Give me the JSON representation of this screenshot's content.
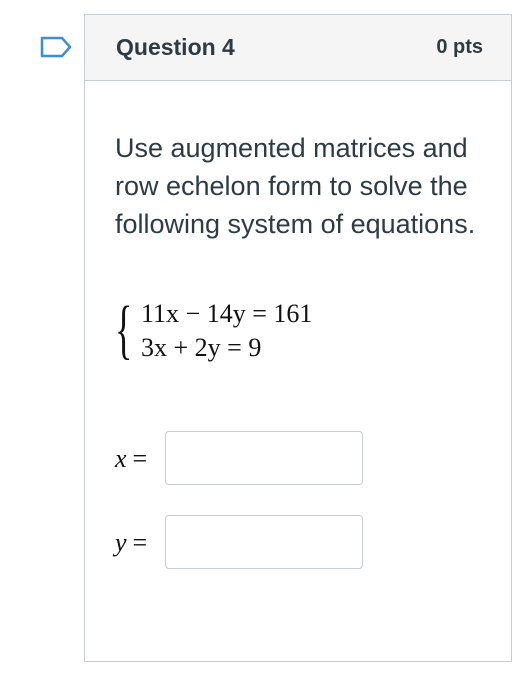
{
  "question": {
    "title": "Question 4",
    "points": "0 pts",
    "flag_icon": "flag-outline-icon",
    "prompt": "Use augmented matrices and row echelon form to solve the following system of equations.",
    "system": {
      "eq1": "11x − 14y = 161",
      "eq2": "3x + 2y = 9"
    },
    "answers": [
      {
        "var": "x",
        "eq": "=",
        "value": ""
      },
      {
        "var": "y",
        "eq": "=",
        "value": ""
      }
    ]
  },
  "colors": {
    "header_bg": "#f5f5f5",
    "border": "#c7cdd1",
    "flag": "#3d8ed6",
    "text": "#2d3b45"
  }
}
